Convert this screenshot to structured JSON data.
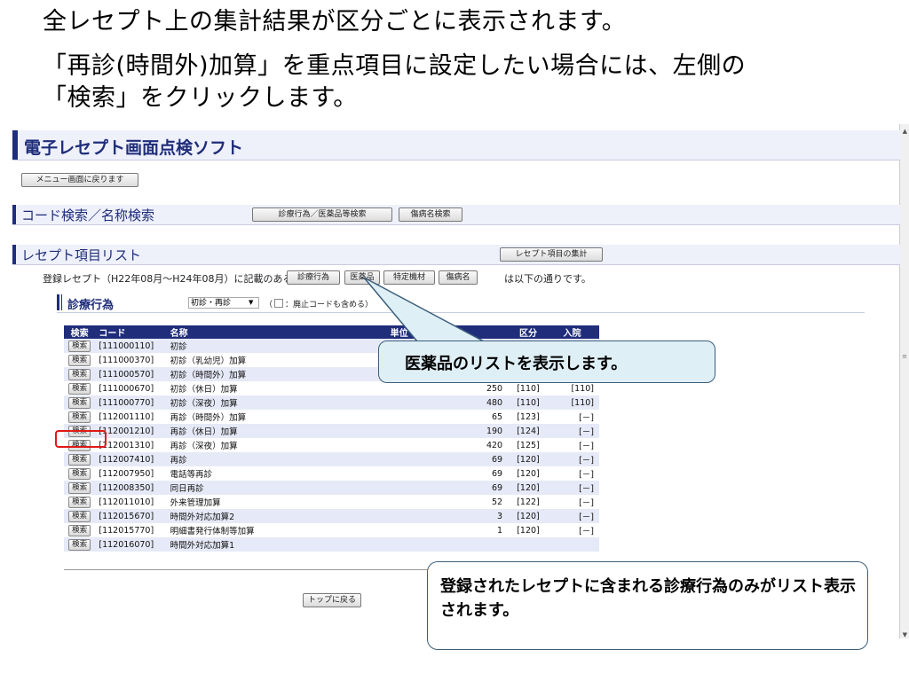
{
  "slide": {
    "line1": "全レセプト上の集計結果が区分ごとに表示されます。",
    "line2": "「再診(時間外)加算」を重点項目に設定したい場合には、左側の",
    "line3": "「検索」をクリックします。"
  },
  "app": {
    "title": "電子レセプト画面点検ソフト",
    "menu_return_label": "メニュー画面に戻ります",
    "top_return_label": "トップに戻る"
  },
  "code_search": {
    "title": "コード検索／名称検索",
    "shinryo_button": "診療行為／医薬品等検索",
    "byomei_button": "傷病名検索"
  },
  "receipt_list": {
    "title": "レセプト項目リスト",
    "summary_button": "レセプト項目の集計",
    "registered_text": "登録レセプト（H22年08月～H24年08月）に記載のある",
    "registered_suffix": "は以下の通りです。",
    "type_buttons": [
      "診療行為",
      "医薬品",
      "特定機材",
      "傷病名"
    ]
  },
  "subsection": {
    "title": "診療行為",
    "category_select_value": "初診・再診",
    "abolished_note_prefix": "（",
    "abolished_note": "：廃止コードも含める）"
  },
  "table": {
    "headers": [
      "検索",
      "コード",
      "名称",
      "単位",
      "区分",
      "入院"
    ],
    "search_label": "検索",
    "rows": [
      {
        "code": "[111000110]",
        "name": "初診",
        "tani": "",
        "kubun": "",
        "nyuin": ""
      },
      {
        "code": "[111000370]",
        "name": "初診（乳幼児）加算",
        "tani": "",
        "kubun": "",
        "nyuin": ""
      },
      {
        "code": "[111000570]",
        "name": "初診（時間外）加算",
        "tani": "",
        "kubun": "",
        "nyuin": ""
      },
      {
        "code": "[111000670]",
        "name": "初診（休日）加算",
        "tani": "250",
        "kubun": "[110]",
        "nyuin": "[110]"
      },
      {
        "code": "[111000770]",
        "name": "初診（深夜）加算",
        "tani": "480",
        "kubun": "[110]",
        "nyuin": "[110]"
      },
      {
        "code": "[112001110]",
        "name": "再診（時間外）加算",
        "tani": "65",
        "kubun": "[123]",
        "nyuin": "[－]"
      },
      {
        "code": "[112001210]",
        "name": "再診（休日）加算",
        "tani": "190",
        "kubun": "[124]",
        "nyuin": "[－]"
      },
      {
        "code": "[112001310]",
        "name": "再診（深夜）加算",
        "tani": "420",
        "kubun": "[125]",
        "nyuin": "[－]"
      },
      {
        "code": "[112007410]",
        "name": "再診",
        "tani": "69",
        "kubun": "[120]",
        "nyuin": "[－]"
      },
      {
        "code": "[112007950]",
        "name": "電話等再診",
        "tani": "69",
        "kubun": "[120]",
        "nyuin": "[－]"
      },
      {
        "code": "[112008350]",
        "name": "同日再診",
        "tani": "69",
        "kubun": "[120]",
        "nyuin": "[－]"
      },
      {
        "code": "[112011010]",
        "name": "外来管理加算",
        "tani": "52",
        "kubun": "[122]",
        "nyuin": "[－]"
      },
      {
        "code": "[112015670]",
        "name": "時間外対応加算2",
        "tani": "3",
        "kubun": "[120]",
        "nyuin": "[－]"
      },
      {
        "code": "[112015770]",
        "name": "明細書発行体制等加算",
        "tani": "1",
        "kubun": "[120]",
        "nyuin": "[－]"
      },
      {
        "code": "[112016070]",
        "name": "時間外対応加算1",
        "tani": "",
        "kubun": "",
        "nyuin": ""
      }
    ]
  },
  "callouts": {
    "medicine": "医薬品のリストを表示します。",
    "list_info": "登録されたレセプトに含まれる診療行為のみがリスト表示されます。"
  },
  "colors": {
    "navy": "#1f2d7a",
    "highlight": "#e01818",
    "callout_fill": "#dfeff6"
  }
}
